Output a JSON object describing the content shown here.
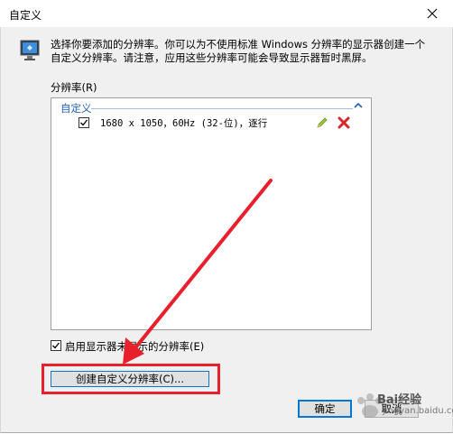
{
  "window": {
    "title": "自定义"
  },
  "description": "选择你要添加的分辨率。你可以为不使用标准 Windows 分辨率的显示器创建一个自定义分辨率。请注意，应用这些分辨率可能会导致显示器暂时黑屏。",
  "resolution_list": {
    "label": "分辨率(R)",
    "group": {
      "header": "自定义",
      "items": [
        {
          "text": "1680 x 1050，60Hz (32-位)，逐行",
          "checked": true
        }
      ]
    }
  },
  "show_unsupported": {
    "label": "启用显示器未显示的分辨率(E)",
    "checked": true
  },
  "buttons": {
    "create": "创建自定义分辨率(C)...",
    "ok": "确定",
    "cancel": "取消"
  },
  "watermark": {
    "brand": "Bai经验",
    "url": "jingyan.baidu.com"
  },
  "colors": {
    "annotation": "#e8202c",
    "accent": "#0078d7",
    "group_header": "#1e5fbd"
  }
}
